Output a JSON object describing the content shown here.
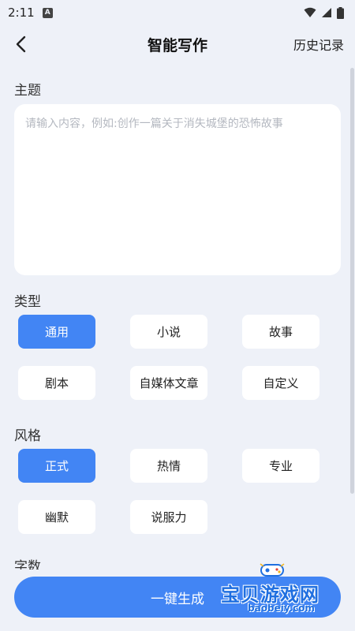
{
  "status_bar": {
    "time": "2:11",
    "app_icon": "A",
    "icons": [
      "wifi-icon",
      "signal-icon",
      "battery-icon"
    ]
  },
  "header": {
    "title": "智能写作",
    "history_label": "历史记录"
  },
  "topic": {
    "label": "主题",
    "placeholder": "请输入内容，例如:创作一篇关于消失城堡的恐怖故事",
    "value": ""
  },
  "type": {
    "label": "类型",
    "options": [
      "通用",
      "小说",
      "故事",
      "剧本",
      "自媒体文章",
      "自定义"
    ],
    "selected": "通用"
  },
  "style": {
    "label": "风格",
    "options": [
      "正式",
      "热情",
      "专业",
      "幽默",
      "说服力"
    ],
    "selected": "正式"
  },
  "word_count": {
    "label": "字数"
  },
  "generate_button": {
    "label": "一键生成"
  },
  "watermark": {
    "text": "宝贝游戏网",
    "url": "baobeiy.com"
  },
  "colors": {
    "accent": "#4285f4",
    "background": "#eef1f8",
    "card": "#ffffff"
  }
}
